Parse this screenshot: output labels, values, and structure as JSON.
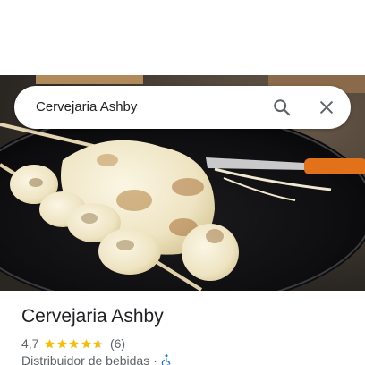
{
  "search": {
    "query": "Cervejaria Ashby"
  },
  "place": {
    "name": "Cervejaria Ashby",
    "rating": "4,7",
    "rating_fraction": 0.94,
    "review_count": "(6)",
    "category": "Distribuidor de bebidas",
    "separator": "·"
  },
  "icons": {
    "search": "search-icon",
    "close": "close-icon",
    "star": "star-icon",
    "accessibility": "wheelchair-icon"
  },
  "colors": {
    "star": "#fbbc04",
    "accessibility": "#1a73e8",
    "text_primary": "#202124",
    "text_secondary": "#5f6368"
  }
}
